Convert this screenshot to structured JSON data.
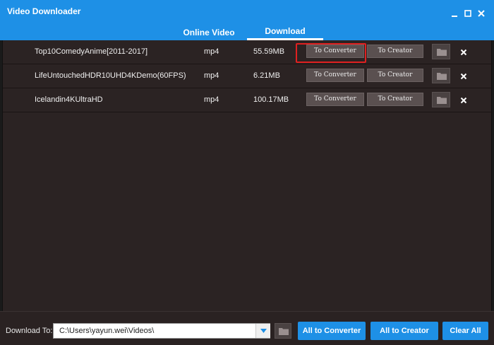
{
  "window": {
    "title": "Video Downloader"
  },
  "tabs": [
    {
      "label": "Online Video",
      "active": false
    },
    {
      "label": "Download",
      "active": true
    }
  ],
  "downloads": [
    {
      "name": "Top10ComedyAnime[2011-2017]",
      "format": "mp4",
      "size": "55.59MB",
      "to_converter": "To Converter",
      "to_creator": "To Creator"
    },
    {
      "name": "LifeUntouchedHDR10UHD4KDemo(60FPS)",
      "format": "mp4",
      "size": "6.21MB",
      "to_converter": "To Converter",
      "to_creator": "To Creator"
    },
    {
      "name": "Icelandin4KUltraHD",
      "format": "mp4",
      "size": "100.17MB",
      "to_converter": "To Converter",
      "to_creator": "To Creator"
    }
  ],
  "bottom": {
    "download_to_label": "Download To:",
    "path": "C:\\Users\\yayun.wei\\Videos\\",
    "all_to_converter": "All to Converter",
    "all_to_creator": "All to Creator",
    "clear_all": "Clear All"
  },
  "colors": {
    "accent": "#1e90e6",
    "highlight": "#e02020",
    "list_bg": "#2b2323"
  }
}
